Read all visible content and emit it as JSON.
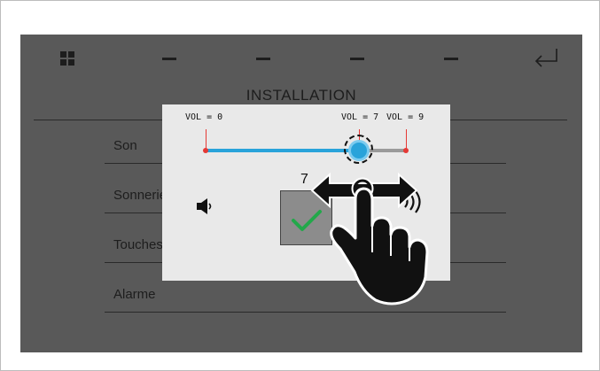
{
  "topbar": {
    "buttons": [
      "home-grid-icon",
      "dash-icon",
      "dash-icon",
      "dash-icon",
      "dash-icon",
      "return-arrow-icon"
    ]
  },
  "page": {
    "title": "INSTALLATION"
  },
  "menu": {
    "items": [
      {
        "label": "Son"
      },
      {
        "label": "Sonneries"
      },
      {
        "label": "Touches"
      },
      {
        "label": "Alarme"
      }
    ]
  },
  "volume_dialog": {
    "min_label": "VOL = 0",
    "current_label": "VOL = 7",
    "max_label": "VOL = 9",
    "value_text": "7",
    "min": 0,
    "max": 9,
    "value": 7,
    "colors": {
      "track_active": "#29a3da",
      "track_inactive": "#9a9a9a",
      "marker": "#e53935",
      "confirm": "#22a84a"
    },
    "icons": [
      "speaker-icon",
      "confirm-check-icon",
      "sound-waves-icon",
      "hand-swipe-icon"
    ]
  }
}
